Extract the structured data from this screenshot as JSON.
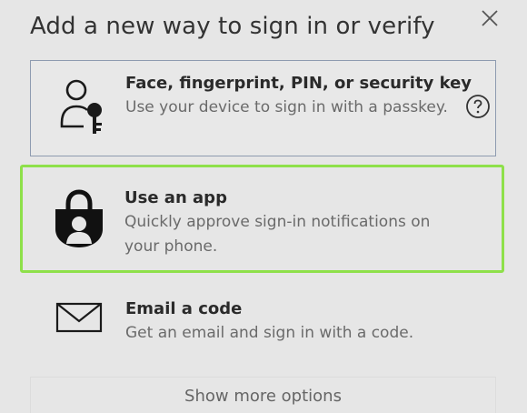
{
  "dialog": {
    "title": "Add a new way to sign in or verify"
  },
  "options": [
    {
      "title": "Face, fingerprint, PIN, or security key",
      "description": "Use your device to sign in with a passkey.",
      "icon": "person-key-icon",
      "has_help": true
    },
    {
      "title": "Use an app",
      "description": "Quickly approve sign-in notifications on your phone.",
      "icon": "authenticator-lock-icon",
      "selected": true
    },
    {
      "title": "Email a code",
      "description": "Get an email and sign in with a code.",
      "icon": "envelope-icon"
    }
  ],
  "footer": {
    "more_label": "Show more options"
  },
  "colors": {
    "selected_border": "#8ee04a",
    "passkey_border": "#8e9bb0"
  }
}
